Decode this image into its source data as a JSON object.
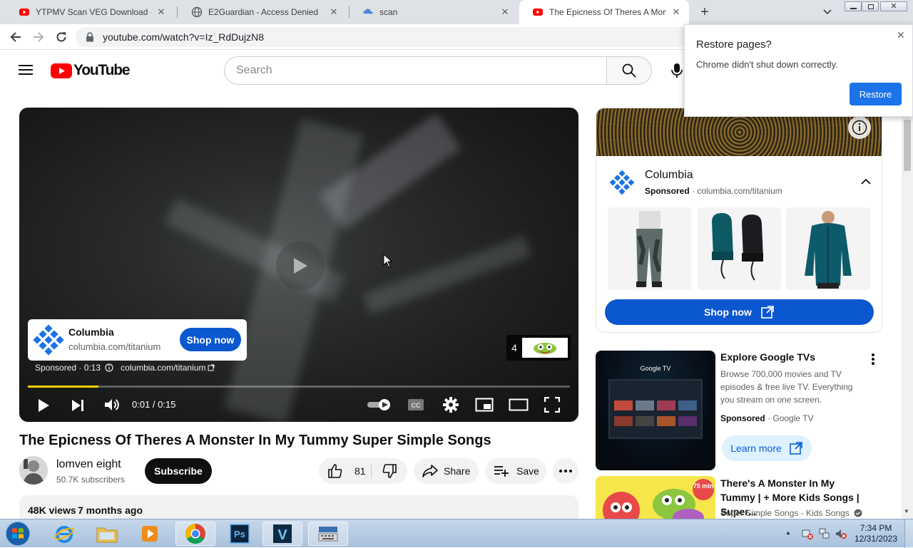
{
  "browser": {
    "tabs": [
      {
        "title": "YTPMV Scan VEG Download - Yo",
        "icon": "youtube-icon"
      },
      {
        "title": "E2Guardian - Access Denied",
        "icon": "globe-icon"
      },
      {
        "title": "scan",
        "icon": "cloud-icon"
      },
      {
        "title": "The Epicness Of Theres A Monste",
        "icon": "youtube-icon"
      }
    ],
    "url": "youtube.com/watch?v=Iz_RdDujzN8"
  },
  "restore_popup": {
    "title": "Restore pages?",
    "message": "Chrome didn't shut down correctly.",
    "button": "Restore"
  },
  "header": {
    "logo_text": "YouTube",
    "search_placeholder": "Search"
  },
  "player": {
    "ad_brand": "Columbia",
    "ad_url": "columbia.com/titanium",
    "ad_cta": "Shop now",
    "sponsored_line": "Sponsored · 0:13",
    "sponsored_url": "columbia.com/titanium",
    "skip_count": "4",
    "time": "0:01 / 0:15",
    "progress": 0.13
  },
  "video": {
    "title": "The Epicness Of Theres A Monster In My Tummy Super Simple Songs",
    "channel": "lomven eight",
    "subscribers": "50.7K subscribers",
    "subscribe_label": "Subscribe",
    "likes": "81",
    "share_label": "Share",
    "save_label": "Save",
    "views": "48K views",
    "age": "7 months ago"
  },
  "side_ad": {
    "brand": "Columbia",
    "sponsored": "Sponsored",
    "url": "columbia.com/titanium",
    "cta": "Shop now"
  },
  "recommendations": [
    {
      "title": "Explore Google TVs",
      "description": "Browse 700,000 movies and TV episodes & free live TV. Everything you stream on one screen.",
      "sponsored": "Sponsored",
      "advertiser": "Google TV",
      "cta": "Learn more",
      "thumb_label": "Google TV"
    },
    {
      "title": "There's A Monster In My Tummy | + More Kids Songs | Super...",
      "channel": "Super Simple Songs - Kids Songs",
      "badge": "75 min"
    }
  ],
  "taskbar": {
    "time": "7:34 PM",
    "date": "12/31/2023"
  },
  "colors": {
    "youtube_red": "#ff0000",
    "link_blue": "#065fd4",
    "cta_blue": "#0b57d0",
    "columbia_blue": "#1a73e8"
  }
}
